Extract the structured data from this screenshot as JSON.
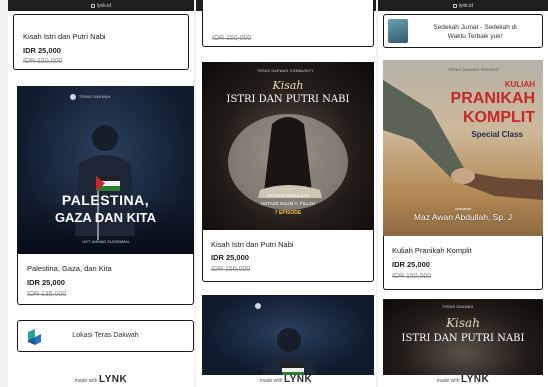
{
  "status_url": "lynk.id",
  "made_with": "made with",
  "made_brand": "LYNK",
  "col1": {
    "top_card": {
      "title": "Kisah Istri dan Putri Nabi",
      "price": "IDR 25,000",
      "old_price": "IDR 150,000"
    },
    "palestina_poster": {
      "brand": "TERAS DAKWAH",
      "line1": "PALESTINA,",
      "line2": "GAZA DAN KITA",
      "speaker": "UST. AHMAD SUDIRMAN"
    },
    "palestina_card": {
      "title": "Palestina, Gaza, dan Kita",
      "price": "IDR 25,000",
      "old_price": "IDR 135,000"
    },
    "location_link": {
      "label": "Lokasi Teras Dakwah"
    }
  },
  "col2": {
    "top_old_price": "IDR 150,000",
    "kisah_poster": {
      "brand": "TERAS DAKWAH COMMUNITY",
      "script": "Kisah",
      "line1": "ISTRI DAN PUTRI NABI",
      "bersama": "Bersama",
      "speaker1": "USTADZ ABDULLAH",
      "speaker2": "USTADZ SALIM A. FILLAH",
      "episode": "7 EPISODE"
    },
    "kisah_card": {
      "title": "Kisah Istri dan Putri Nabi",
      "price": "IDR 25,000",
      "old_price": "IDR 150,000"
    }
  },
  "col3": {
    "banner": {
      "line1": "Sedekah Jumat - Sedekah di",
      "line2": "Waktu Terbaik yuk!"
    },
    "kuliah_poster": {
      "brand": "TERAS DAKWAH PRESENT",
      "line1": "KULIAH",
      "line2": "PRANIKAH",
      "line3": "KOMPLIT",
      "sub": "Special Class",
      "bersama": "bersama",
      "speaker": "Maz Awan Abdullah, Sp. J"
    },
    "kuliah_card": {
      "title": "Kuliah Pranikah Komplit",
      "price": "IDR 25,000",
      "old_price": "IDR 150,000"
    },
    "kisah_poster2": {
      "brand": "TERAS DAKWAH",
      "script": "Kisah",
      "line1": "ISTRI DAN PUTRI NABI"
    }
  },
  "colors": {
    "navy": "#0f1a2c",
    "border": "#1a1a1a",
    "accent_red": "#c62828",
    "accent_yellow": "#f5c542"
  }
}
